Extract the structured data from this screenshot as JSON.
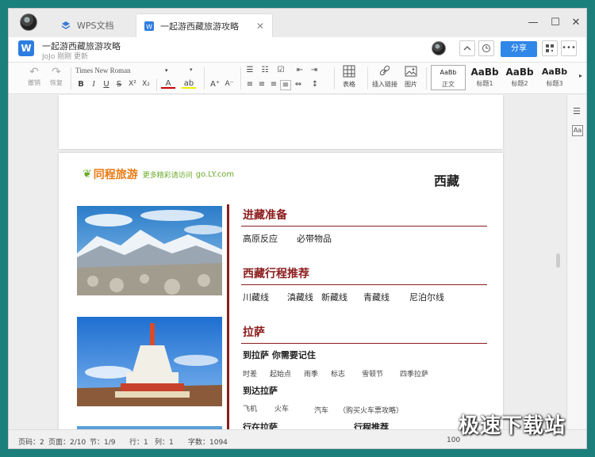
{
  "tabs": [
    {
      "label": "WPS文档"
    },
    {
      "label": "一起游西藏旅游攻略"
    }
  ],
  "window_controls": {
    "minimize": "—",
    "maximize": "☐",
    "close": "✕"
  },
  "doc": {
    "logo_letter": "W",
    "title": "一起游西藏旅游攻略",
    "subtitle": "JoJo 刚刚 更新"
  },
  "header_buttons": {
    "share": "分享"
  },
  "toolbar": {
    "undo": "撤销",
    "redo": "恢复",
    "font_name": "Times New Roman",
    "bold": "B",
    "italic": "I",
    "underline": "U",
    "strike": "S",
    "superscript": "X²",
    "subscript": "X₂",
    "font_color": "A",
    "highlight": "ab",
    "grow": "A⁺",
    "shrink": "A⁻",
    "table": "表格",
    "insert_link": "插入链接",
    "image": "图片",
    "styles": [
      {
        "sample": "AaBb",
        "name": "正文"
      },
      {
        "sample": "AaBb",
        "name": "标题1"
      },
      {
        "sample": "AaBb",
        "name": "标题2"
      },
      {
        "sample": "AaBb",
        "name": "标题3"
      }
    ]
  },
  "page": {
    "logo_brand": "同程旅游",
    "logo_slogan": "更多精彩请访问",
    "logo_url": "go.LY.com",
    "heading": "西藏",
    "sections": [
      {
        "title": "进藏准备",
        "items": [
          "高原反应",
          "必带物品"
        ]
      },
      {
        "title": "西藏行程推荐",
        "items": [
          "川藏线",
          "滇藏线",
          "新藏线",
          "青藏线",
          "尼泊尔线"
        ]
      },
      {
        "title": "拉萨",
        "sub1": "到拉萨 你需要记住",
        "sub1_items": [
          "时差",
          "起始点",
          "雨季",
          "标志",
          "雪顿节",
          "四季拉萨"
        ],
        "sub2": "到达拉萨",
        "sub2_items": [
          "飞机",
          "火车",
          "汽车",
          "（购买火车票攻略）"
        ],
        "sub3": "行在拉萨",
        "sub4": "行程推荐"
      }
    ]
  },
  "status": {
    "page": "页码：2",
    "pages": "页面：2/10",
    "section": "节：1/9",
    "row": "行：1",
    "col": "列：1",
    "words": "字数：1094",
    "zoom": "100"
  },
  "watermark": "极速下载站",
  "colors": {
    "accent": "#2f87e8",
    "section_red": "#8b1c1c",
    "brand_green": "#6aaa2a",
    "brand_orange": "#e87b16"
  }
}
